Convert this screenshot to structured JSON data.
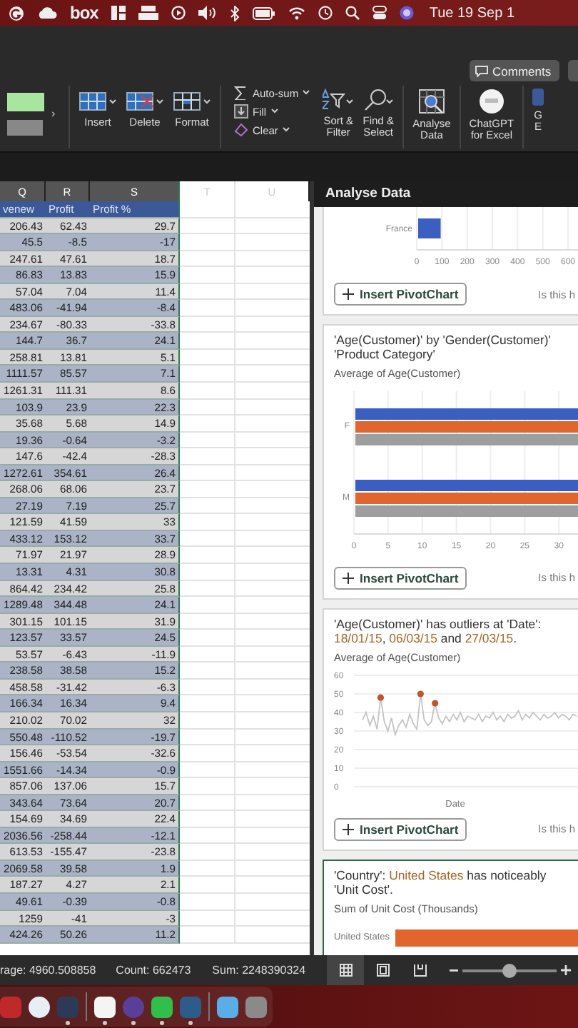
{
  "menu_bar": {
    "logo_text": "box",
    "clock": "Tue 19 Sep 1"
  },
  "ribbon": {
    "comments_button": "Comments",
    "styles_chevron": "›",
    "cells": [
      {
        "label": "Insert"
      },
      {
        "label": "Delete"
      },
      {
        "label": "Format"
      }
    ],
    "editing": [
      {
        "label": "Auto-sum"
      },
      {
        "label": "Fill"
      },
      {
        "label": "Clear"
      }
    ],
    "sort_find": [
      {
        "label": "Sort &\nFilter"
      },
      {
        "label": "Find &\nSelect"
      }
    ],
    "add_ins": [
      {
        "label": "Analyse\nData"
      },
      {
        "label": "ChatGPT\nfor Excel"
      },
      {
        "label": "G\nE"
      }
    ]
  },
  "sheet": {
    "columns": [
      {
        "label": "Q",
        "selected": true
      },
      {
        "label": "R",
        "selected": true
      },
      {
        "label": "S",
        "selected": true
      },
      {
        "label": "T",
        "selected": false
      },
      {
        "label": "U",
        "selected": false
      }
    ],
    "header_row": [
      "venew",
      "Profit",
      "Profit %"
    ],
    "rows": [
      [
        "206.43",
        "62.43",
        "29.7"
      ],
      [
        "45.5",
        "-8.5",
        "-17"
      ],
      [
        "247.61",
        "47.61",
        "18.7"
      ],
      [
        "86.83",
        "13.83",
        "15.9"
      ],
      [
        "57.04",
        "7.04",
        "11.4"
      ],
      [
        "483.06",
        "-41.94",
        "-8.4"
      ],
      [
        "234.67",
        "-80.33",
        "-33.8"
      ],
      [
        "144.7",
        "36.7",
        "24.1"
      ],
      [
        "258.81",
        "13.81",
        "5.1"
      ],
      [
        "1111.57",
        "85.57",
        "7.1"
      ],
      [
        "1261.31",
        "111.31",
        "8.6"
      ],
      [
        "103.9",
        "23.9",
        "22.3"
      ],
      [
        "35.68",
        "5.68",
        "14.9"
      ],
      [
        "19.36",
        "-0.64",
        "-3.2"
      ],
      [
        "147.6",
        "-42.4",
        "-28.3"
      ],
      [
        "1272.61",
        "354.61",
        "26.4"
      ],
      [
        "268.06",
        "68.06",
        "23.7"
      ],
      [
        "27.19",
        "7.19",
        "25.7"
      ],
      [
        "121.59",
        "41.59",
        "33"
      ],
      [
        "433.12",
        "153.12",
        "33.7"
      ],
      [
        "71.97",
        "21.97",
        "28.9"
      ],
      [
        "13.31",
        "4.31",
        "30.8"
      ],
      [
        "864.42",
        "234.42",
        "25.8"
      ],
      [
        "1289.48",
        "344.48",
        "24.1"
      ],
      [
        "301.15",
        "101.15",
        "31.9"
      ],
      [
        "123.57",
        "33.57",
        "24.5"
      ],
      [
        "53.57",
        "-6.43",
        "-11.9"
      ],
      [
        "238.58",
        "38.58",
        "15.2"
      ],
      [
        "458.58",
        "-31.42",
        "-6.3"
      ],
      [
        "166.34",
        "16.34",
        "9.4"
      ],
      [
        "210.02",
        "70.02",
        "32"
      ],
      [
        "550.48",
        "-110.52",
        "-19.7"
      ],
      [
        "156.46",
        "-53.54",
        "-32.6"
      ],
      [
        "1551.66",
        "-14.34",
        "-0.9"
      ],
      [
        "857.06",
        "137.06",
        "15.7"
      ],
      [
        "343.64",
        "73.64",
        "20.7"
      ],
      [
        "154.69",
        "34.69",
        "22.4"
      ],
      [
        "2036.56",
        "-258.44",
        "-12.1"
      ],
      [
        "613.53",
        "-155.47",
        "-23.8"
      ],
      [
        "2069.58",
        "39.58",
        "1.9"
      ],
      [
        "187.27",
        "4.27",
        "2.1"
      ],
      [
        "49.61",
        "-0.39",
        "-0.8"
      ],
      [
        "1259",
        "-41",
        "-3"
      ],
      [
        "424.26",
        "50.26",
        "11.2"
      ]
    ]
  },
  "panel": {
    "title": "Analyse Data",
    "cards": [
      {
        "kind": "bar",
        "selected": false,
        "chart_data": {
          "type": "bar",
          "orientation": "horizontal",
          "categories": [
            "France"
          ],
          "series": [
            {
              "color": "#3a5fc0",
              "values": [
                95
              ]
            }
          ],
          "grid": true,
          "xlim": [
            0,
            600
          ],
          "xticks": [
            0,
            100,
            200,
            300,
            400,
            500,
            600
          ]
        },
        "button": "Insert PivotChart",
        "feedback": "Is this h"
      },
      {
        "kind": "grouped_bar",
        "selected": false,
        "title": "'Age(Customer)' by 'Gender(Customer)'\n'Product Category'",
        "subtitle": "Average of Age(Customer)",
        "chart_data": {
          "type": "bar",
          "orientation": "horizontal",
          "categories": [
            "F",
            "M"
          ],
          "series": [
            {
              "color": "#3a5fc0",
              "values": [
                33,
                33
              ]
            },
            {
              "color": "#e0662e",
              "values": [
                33,
                33
              ]
            },
            {
              "color": "#9e9e9e",
              "values": [
                33,
                33
              ]
            }
          ],
          "grid": true,
          "xlim": [
            0,
            33
          ],
          "xticks": [
            0,
            5,
            10,
            15,
            20,
            25,
            30
          ]
        },
        "button": "Insert PivotChart",
        "feedback": "Is this h"
      },
      {
        "kind": "outliers",
        "selected": false,
        "title_parts": [
          {
            "text": "'Age(Customer)' has outliers at 'Date':\n",
            "highlight": false
          },
          {
            "text": "18/01/15",
            "highlight": true
          },
          {
            "text": ", ",
            "highlight": false
          },
          {
            "text": "06/03/15",
            "highlight": true
          },
          {
            "text": " and ",
            "highlight": false
          },
          {
            "text": "27/03/15",
            "highlight": true
          },
          {
            "text": ".",
            "highlight": false
          }
        ],
        "subtitle": "Average of Age(Customer)",
        "chart_data": {
          "type": "line",
          "xlabel": "Date",
          "ylim": [
            0,
            60
          ],
          "yticks": [
            0,
            10,
            20,
            30,
            40,
            50,
            60
          ],
          "grid": true,
          "series": [
            {
              "color": "#c4c4c4",
              "values": [
                36,
                40,
                33,
                38,
                31,
                48,
                35,
                30,
                37,
                28,
                33,
                36,
                32,
                39,
                34,
                31,
                50,
                36,
                33,
                35,
                45,
                37,
                34,
                38,
                35,
                39,
                36,
                40,
                35,
                38,
                37,
                36,
                39,
                35,
                38,
                37,
                40,
                36,
                38,
                35,
                39,
                37,
                38,
                41,
                36,
                39,
                37,
                40,
                38,
                36,
                39,
                37,
                38,
                40,
                37,
                39,
                38,
                36,
                39,
                38
              ]
            }
          ]
        },
        "button": "Insert PivotChart",
        "feedback": "Is this h"
      },
      {
        "kind": "highlight_bar",
        "selected": true,
        "title_parts": [
          {
            "text": "'Country': ",
            "highlight": false
          },
          {
            "text": "United States",
            "highlight": true
          },
          {
            "text": " has noticeably\n'Unit Cost'.",
            "highlight": false
          }
        ],
        "subtitle": "Sum of Unit Cost (Thousands)",
        "category": "United States"
      }
    ]
  },
  "status_bar": {
    "average": "rage: 4960.508858",
    "count": "Count: 662473",
    "sum": "Sum: 2248390324",
    "views": [
      {
        "selected": true
      },
      {
        "selected": false
      },
      {
        "selected": false
      }
    ],
    "zoom": {
      "level": 0.5
    }
  },
  "dock": {
    "apps": [
      {
        "running": false
      },
      {
        "running": false
      },
      {
        "running": true
      },
      {
        "running": true
      },
      {
        "running": true
      },
      {
        "running": true
      },
      {
        "running": true
      },
      {
        "running": false
      },
      {
        "running": false
      }
    ]
  }
}
